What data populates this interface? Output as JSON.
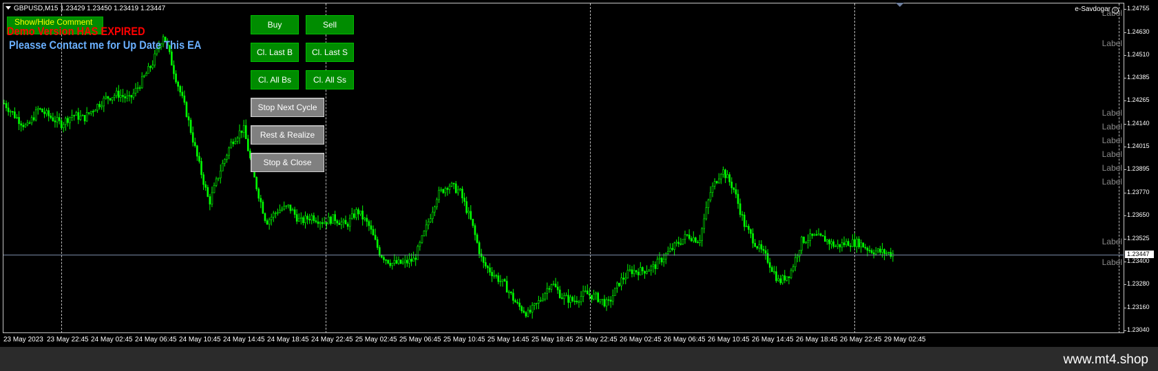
{
  "chart": {
    "symbol_line": "GBPUSD,M15  1.23429 1.23450 1.23419 1.23447",
    "brand": "e-Savdogar",
    "brand_icon": "smiley-icon",
    "current_price": "1.23447",
    "candle_color": "#00ff00",
    "background_color": "#000000"
  },
  "overlay": {
    "comment_button": "Show/Hide Comment",
    "expired_text": "Demo Version HAS EXPIRED",
    "contact_text": "Pleasse Contact me for Up Date This EA"
  },
  "buttons": {
    "buy": "Buy",
    "sell": "Sell",
    "close_last_buy": "Cl. Last B",
    "close_last_sell": "Cl. Last S",
    "close_all_buys": "Cl. All Bs",
    "close_all_sells": "Cl. All Ss",
    "stop_next_cycle": "Stop Next Cycle",
    "rest_realize": "Rest & Realize",
    "stop_close": "Stop & Close"
  },
  "labels": [
    "Label",
    "Label",
    "Label",
    "Label",
    "Label",
    "Label",
    "Label",
    "Label",
    "Label",
    "Label"
  ],
  "y_axis": [
    "1.24755",
    "1.24630",
    "1.24510",
    "1.24385",
    "1.24265",
    "1.24140",
    "1.24015",
    "1.23895",
    "1.23770",
    "1.23650",
    "1.23525",
    "1.23400",
    "1.23280",
    "1.23160",
    "1.23040"
  ],
  "x_axis": [
    "23 May 2023",
    "23 May 22:45",
    "24 May 02:45",
    "24 May 06:45",
    "24 May 10:45",
    "24 May 14:45",
    "24 May 18:45",
    "24 May 22:45",
    "25 May 02:45",
    "25 May 06:45",
    "25 May 10:45",
    "25 May 14:45",
    "25 May 18:45",
    "25 May 22:45",
    "26 May 02:45",
    "26 May 06:45",
    "26 May 10:45",
    "26 May 14:45",
    "26 May 18:45",
    "26 May 22:45",
    "29 May 02:45"
  ],
  "footer": {
    "site": "www.mt4.shop"
  },
  "price_path": [
    1.2425,
    1.2418,
    1.2412,
    1.2422,
    1.2418,
    1.2414,
    1.2419,
    1.2417,
    1.2423,
    1.2428,
    1.243,
    1.2427,
    1.2436,
    1.2446,
    1.2462,
    1.244,
    1.242,
    1.2395,
    1.2372,
    1.239,
    1.2405,
    1.2412,
    1.2384,
    1.2362,
    1.2368,
    1.237,
    1.2362,
    1.2365,
    1.2362,
    1.2364,
    1.236,
    1.2368,
    1.236,
    1.2345,
    1.234,
    1.234,
    1.2342,
    1.2358,
    1.2376,
    1.2382,
    1.2378,
    1.2362,
    1.234,
    1.2334,
    1.2328,
    1.2318,
    1.2313,
    1.232,
    1.233,
    1.2322,
    1.232,
    1.2324,
    1.2322,
    1.2318,
    1.233,
    1.2336,
    1.2336,
    1.2338,
    1.2344,
    1.235,
    1.2355,
    1.2352,
    1.2378,
    1.239,
    1.238,
    1.236,
    1.235,
    1.2342,
    1.233,
    1.2335,
    1.2352,
    1.2354,
    1.2353,
    1.2349,
    1.2351,
    1.2351,
    1.2347,
    1.2346,
    1.2345
  ]
}
